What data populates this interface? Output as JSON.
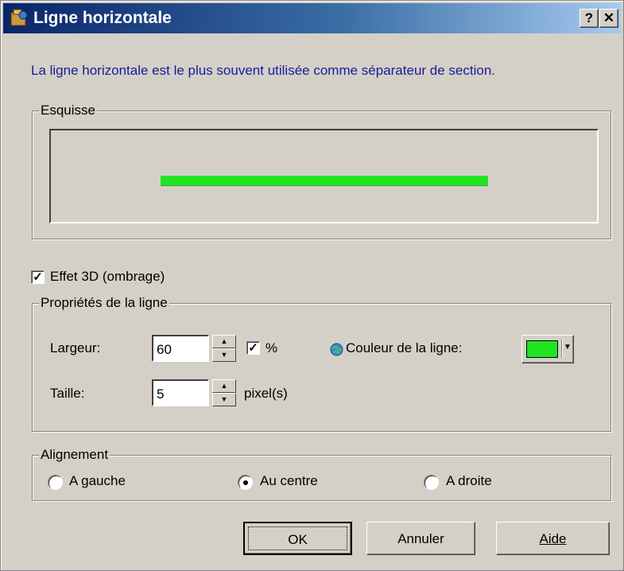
{
  "window": {
    "title": "Ligne horizontale",
    "help_button": "?",
    "close_button": "✕"
  },
  "intro_text": "La ligne horizontale est le plus souvent utilisée comme séparateur de section.",
  "sketch": {
    "label": "Esquisse",
    "line_color": "#22e322",
    "line_width_percent": 60
  },
  "effect_3d": {
    "label": "Effet 3D (ombrage)",
    "checked": true
  },
  "line_properties": {
    "label": "Propriétés de la ligne",
    "width_label": "Largeur:",
    "width_value": "60",
    "percent_checked": true,
    "percent_label": "%",
    "size_label": "Taille:",
    "size_value": "5",
    "size_unit": "pixel(s)",
    "color_label": "Couleur de la ligne:",
    "color_value": "#22e322"
  },
  "alignment": {
    "label": "Alignement",
    "options": [
      "A gauche",
      "Au centre",
      "A droite"
    ],
    "selected": "Au centre"
  },
  "buttons": {
    "ok": "OK",
    "cancel": "Annuler",
    "help": "Aide"
  }
}
